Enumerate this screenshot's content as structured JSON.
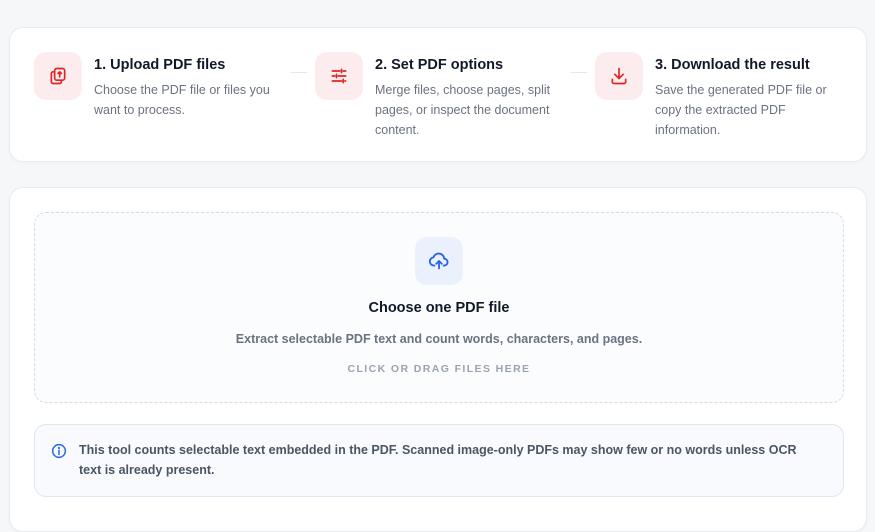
{
  "steps": [
    {
      "icon": "copy-files-icon",
      "title": "1. Upload PDF files",
      "description": "Choose the PDF file or files you want to process."
    },
    {
      "icon": "sliders-icon",
      "title": "2. Set PDF options",
      "description": "Merge files, choose pages, split pages, or inspect the document content."
    },
    {
      "icon": "download-icon",
      "title": "3. Download the result",
      "description": "Save the generated PDF file or copy the extracted PDF information."
    }
  ],
  "dropzone": {
    "icon": "cloud-upload-icon",
    "title": "Choose one PDF file",
    "subtitle": "Extract selectable PDF text and count words, characters, and pages.",
    "hint": "CLICK OR DRAG FILES HERE"
  },
  "notice": {
    "icon": "info-icon",
    "text": "This tool counts selectable text embedded in the PDF. Scanned image-only PDFs may show few or no words unless OCR text is already present."
  },
  "colors": {
    "accent_red": "#dc2626",
    "accent_blue": "#2563eb",
    "step_icon_bg": "#fdeced",
    "upload_icon_bg": "#eaf1fd"
  }
}
